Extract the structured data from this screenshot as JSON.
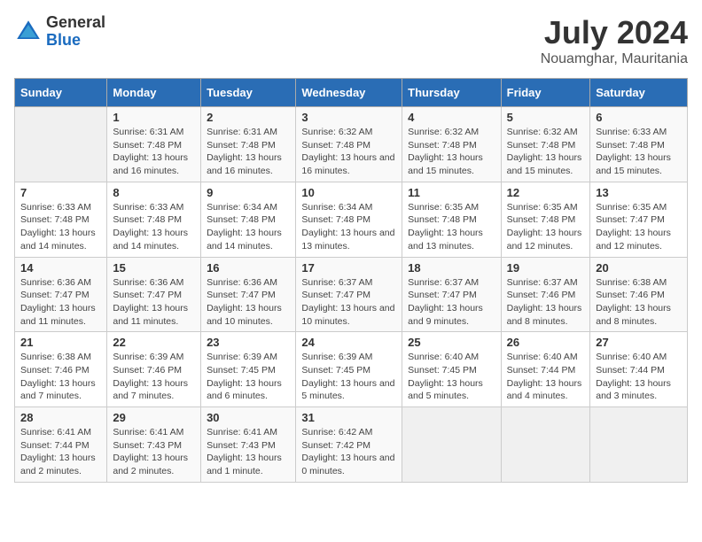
{
  "header": {
    "logo_general": "General",
    "logo_blue": "Blue",
    "month": "July 2024",
    "location": "Nouamghar, Mauritania"
  },
  "days_of_week": [
    "Sunday",
    "Monday",
    "Tuesday",
    "Wednesday",
    "Thursday",
    "Friday",
    "Saturday"
  ],
  "weeks": [
    [
      {
        "day": "",
        "sunrise": "",
        "sunset": "",
        "daylight": ""
      },
      {
        "day": "1",
        "sunrise": "Sunrise: 6:31 AM",
        "sunset": "Sunset: 7:48 PM",
        "daylight": "Daylight: 13 hours and 16 minutes."
      },
      {
        "day": "2",
        "sunrise": "Sunrise: 6:31 AM",
        "sunset": "Sunset: 7:48 PM",
        "daylight": "Daylight: 13 hours and 16 minutes."
      },
      {
        "day": "3",
        "sunrise": "Sunrise: 6:32 AM",
        "sunset": "Sunset: 7:48 PM",
        "daylight": "Daylight: 13 hours and 16 minutes."
      },
      {
        "day": "4",
        "sunrise": "Sunrise: 6:32 AM",
        "sunset": "Sunset: 7:48 PM",
        "daylight": "Daylight: 13 hours and 15 minutes."
      },
      {
        "day": "5",
        "sunrise": "Sunrise: 6:32 AM",
        "sunset": "Sunset: 7:48 PM",
        "daylight": "Daylight: 13 hours and 15 minutes."
      },
      {
        "day": "6",
        "sunrise": "Sunrise: 6:33 AM",
        "sunset": "Sunset: 7:48 PM",
        "daylight": "Daylight: 13 hours and 15 minutes."
      }
    ],
    [
      {
        "day": "7",
        "sunrise": "Sunrise: 6:33 AM",
        "sunset": "Sunset: 7:48 PM",
        "daylight": "Daylight: 13 hours and 14 minutes."
      },
      {
        "day": "8",
        "sunrise": "Sunrise: 6:33 AM",
        "sunset": "Sunset: 7:48 PM",
        "daylight": "Daylight: 13 hours and 14 minutes."
      },
      {
        "day": "9",
        "sunrise": "Sunrise: 6:34 AM",
        "sunset": "Sunset: 7:48 PM",
        "daylight": "Daylight: 13 hours and 14 minutes."
      },
      {
        "day": "10",
        "sunrise": "Sunrise: 6:34 AM",
        "sunset": "Sunset: 7:48 PM",
        "daylight": "Daylight: 13 hours and 13 minutes."
      },
      {
        "day": "11",
        "sunrise": "Sunrise: 6:35 AM",
        "sunset": "Sunset: 7:48 PM",
        "daylight": "Daylight: 13 hours and 13 minutes."
      },
      {
        "day": "12",
        "sunrise": "Sunrise: 6:35 AM",
        "sunset": "Sunset: 7:48 PM",
        "daylight": "Daylight: 13 hours and 12 minutes."
      },
      {
        "day": "13",
        "sunrise": "Sunrise: 6:35 AM",
        "sunset": "Sunset: 7:47 PM",
        "daylight": "Daylight: 13 hours and 12 minutes."
      }
    ],
    [
      {
        "day": "14",
        "sunrise": "Sunrise: 6:36 AM",
        "sunset": "Sunset: 7:47 PM",
        "daylight": "Daylight: 13 hours and 11 minutes."
      },
      {
        "day": "15",
        "sunrise": "Sunrise: 6:36 AM",
        "sunset": "Sunset: 7:47 PM",
        "daylight": "Daylight: 13 hours and 11 minutes."
      },
      {
        "day": "16",
        "sunrise": "Sunrise: 6:36 AM",
        "sunset": "Sunset: 7:47 PM",
        "daylight": "Daylight: 13 hours and 10 minutes."
      },
      {
        "day": "17",
        "sunrise": "Sunrise: 6:37 AM",
        "sunset": "Sunset: 7:47 PM",
        "daylight": "Daylight: 13 hours and 10 minutes."
      },
      {
        "day": "18",
        "sunrise": "Sunrise: 6:37 AM",
        "sunset": "Sunset: 7:47 PM",
        "daylight": "Daylight: 13 hours and 9 minutes."
      },
      {
        "day": "19",
        "sunrise": "Sunrise: 6:37 AM",
        "sunset": "Sunset: 7:46 PM",
        "daylight": "Daylight: 13 hours and 8 minutes."
      },
      {
        "day": "20",
        "sunrise": "Sunrise: 6:38 AM",
        "sunset": "Sunset: 7:46 PM",
        "daylight": "Daylight: 13 hours and 8 minutes."
      }
    ],
    [
      {
        "day": "21",
        "sunrise": "Sunrise: 6:38 AM",
        "sunset": "Sunset: 7:46 PM",
        "daylight": "Daylight: 13 hours and 7 minutes."
      },
      {
        "day": "22",
        "sunrise": "Sunrise: 6:39 AM",
        "sunset": "Sunset: 7:46 PM",
        "daylight": "Daylight: 13 hours and 7 minutes."
      },
      {
        "day": "23",
        "sunrise": "Sunrise: 6:39 AM",
        "sunset": "Sunset: 7:45 PM",
        "daylight": "Daylight: 13 hours and 6 minutes."
      },
      {
        "day": "24",
        "sunrise": "Sunrise: 6:39 AM",
        "sunset": "Sunset: 7:45 PM",
        "daylight": "Daylight: 13 hours and 5 minutes."
      },
      {
        "day": "25",
        "sunrise": "Sunrise: 6:40 AM",
        "sunset": "Sunset: 7:45 PM",
        "daylight": "Daylight: 13 hours and 5 minutes."
      },
      {
        "day": "26",
        "sunrise": "Sunrise: 6:40 AM",
        "sunset": "Sunset: 7:44 PM",
        "daylight": "Daylight: 13 hours and 4 minutes."
      },
      {
        "day": "27",
        "sunrise": "Sunrise: 6:40 AM",
        "sunset": "Sunset: 7:44 PM",
        "daylight": "Daylight: 13 hours and 3 minutes."
      }
    ],
    [
      {
        "day": "28",
        "sunrise": "Sunrise: 6:41 AM",
        "sunset": "Sunset: 7:44 PM",
        "daylight": "Daylight: 13 hours and 2 minutes."
      },
      {
        "day": "29",
        "sunrise": "Sunrise: 6:41 AM",
        "sunset": "Sunset: 7:43 PM",
        "daylight": "Daylight: 13 hours and 2 minutes."
      },
      {
        "day": "30",
        "sunrise": "Sunrise: 6:41 AM",
        "sunset": "Sunset: 7:43 PM",
        "daylight": "Daylight: 13 hours and 1 minute."
      },
      {
        "day": "31",
        "sunrise": "Sunrise: 6:42 AM",
        "sunset": "Sunset: 7:42 PM",
        "daylight": "Daylight: 13 hours and 0 minutes."
      },
      {
        "day": "",
        "sunrise": "",
        "sunset": "",
        "daylight": ""
      },
      {
        "day": "",
        "sunrise": "",
        "sunset": "",
        "daylight": ""
      },
      {
        "day": "",
        "sunrise": "",
        "sunset": "",
        "daylight": ""
      }
    ]
  ]
}
